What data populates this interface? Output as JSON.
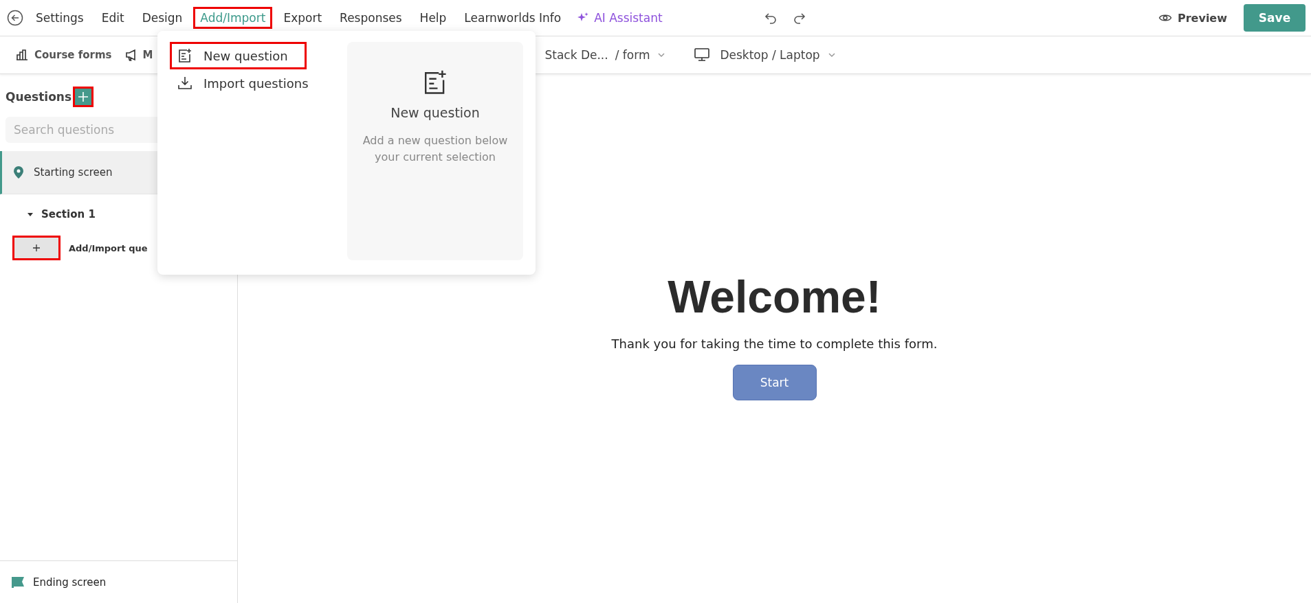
{
  "menu_bar": {
    "items": [
      {
        "label": "Settings",
        "selected": false,
        "highlighted": false
      },
      {
        "label": "Edit",
        "selected": false,
        "highlighted": false
      },
      {
        "label": "Design",
        "selected": false,
        "highlighted": false
      },
      {
        "label": "Add/Import",
        "selected": true,
        "highlighted": true
      },
      {
        "label": "Export",
        "selected": false,
        "highlighted": false
      },
      {
        "label": "Responses",
        "selected": false,
        "highlighted": false
      },
      {
        "label": "Help",
        "selected": false,
        "highlighted": false
      },
      {
        "label": "Learnworlds Info",
        "selected": false,
        "highlighted": false
      }
    ],
    "ai_assistant": "AI Assistant",
    "preview": "Preview",
    "save": "Save"
  },
  "toolbar": {
    "course_forms": "Course forms",
    "marketing": "M",
    "stack": "Stack De...",
    "form": "/ form",
    "device": "Desktop / Laptop"
  },
  "sidebar": {
    "title": "Questions",
    "add_highlighted": true,
    "search": {
      "placeholder": "Search questions"
    },
    "starting_screen": {
      "label": "Starting screen",
      "selected": true
    },
    "section": {
      "label": "Section 1",
      "expanded": true
    },
    "add_import": {
      "label": "Add/Import que",
      "highlighted": true
    },
    "ending_screen": "Ending screen"
  },
  "dropdown": {
    "items": [
      {
        "label": "New question",
        "highlighted": true,
        "kind": "new"
      },
      {
        "label": "Import questions",
        "highlighted": false,
        "kind": "import"
      }
    ],
    "preview": {
      "title": "New question",
      "description": "Add a new question below your current selection"
    }
  },
  "canvas": {
    "heading": "Welcome!",
    "text": "Thank you for taking the time to complete this form.",
    "button": "Start"
  }
}
